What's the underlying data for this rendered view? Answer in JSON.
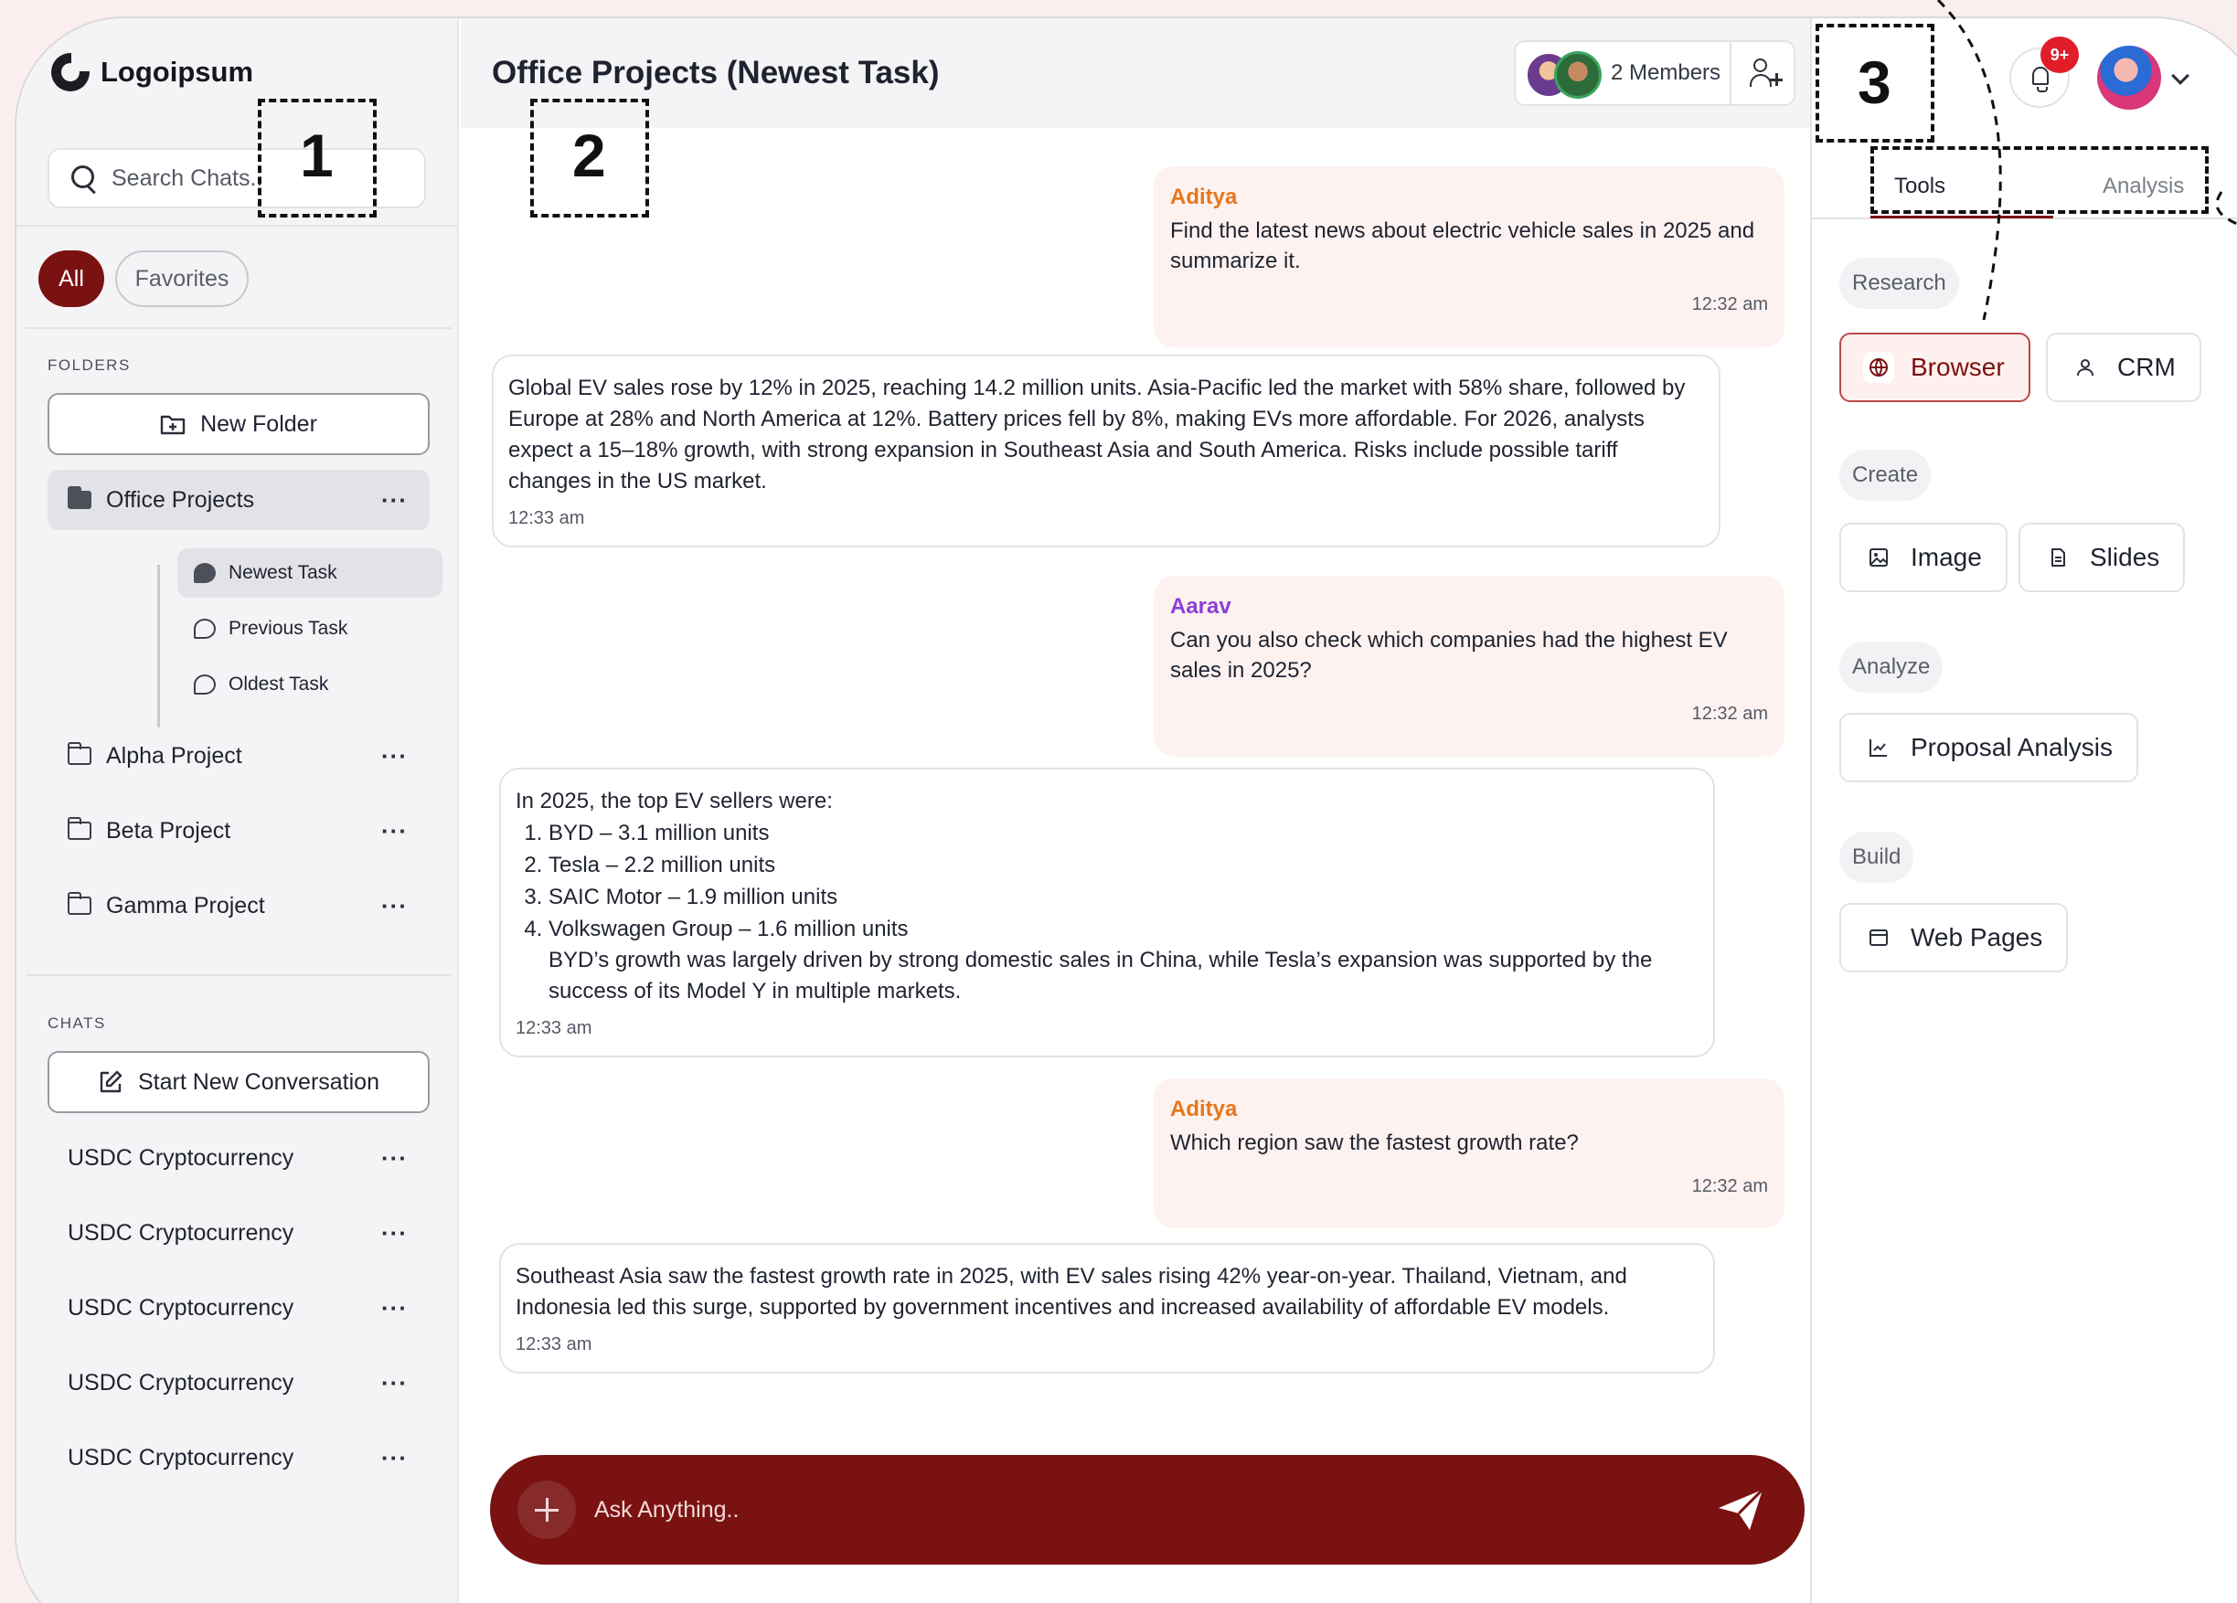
{
  "app": {
    "logo": "Logoipsum"
  },
  "sidebar": {
    "search_placeholder": "Search Chats..",
    "filters": {
      "all": "All",
      "favorites": "Favorites"
    },
    "folders_label": "FOLDERS",
    "new_folder": "New Folder",
    "folders": [
      {
        "label": "Office Projects",
        "active": true
      },
      {
        "label": "Alpha Project"
      },
      {
        "label": "Beta Project"
      },
      {
        "label": "Gamma Project"
      }
    ],
    "subtasks": [
      {
        "label": "Newest Task",
        "active": true
      },
      {
        "label": "Previous Task"
      },
      {
        "label": "Oldest Task"
      }
    ],
    "chats_label": "CHATS",
    "new_conversation": "Start New Conversation",
    "chats": [
      {
        "label": "USDC Cryptocurrency"
      },
      {
        "label": "USDC Cryptocurrency"
      },
      {
        "label": "USDC Cryptocurrency"
      },
      {
        "label": "USDC Cryptocurrency"
      },
      {
        "label": "USDC Cryptocurrency"
      }
    ],
    "more_glyph": "···"
  },
  "header": {
    "title": "Office Projects (Newest Task)",
    "members": "2 Members"
  },
  "messages": [
    {
      "role": "user",
      "name": "Aditya",
      "color": "#e8761b",
      "text": "Find the latest news about electric vehicle sales in 2025 and summarize it.",
      "time": "12:32 am"
    },
    {
      "role": "ai",
      "text": "Global EV sales rose by 12% in 2025, reaching 14.2 million units. Asia-Pacific led the market with 58% share, followed by Europe at 28% and North America at 12%. Battery prices fell by 8%, making EVs more affordable. For 2026, analysts expect a 15–18% growth, with strong expansion in Southeast Asia and South America. Risks include possible tariff changes in the US market.",
      "time": "12:33 am"
    },
    {
      "role": "user",
      "name": "Aarav",
      "color": "#8b3fd9",
      "text": "Can you also check which companies had the highest EV sales in 2025?",
      "time": "12:32 am"
    },
    {
      "role": "ai",
      "intro": "In 2025, the top EV sellers were:",
      "list": [
        "BYD – 3.1 million units",
        "Tesla – 2.2 million units",
        "SAIC Motor – 1.9 million units",
        "Volkswagen Group – 1.6 million units"
      ],
      "text": "BYD’s growth was largely driven by strong domestic sales in China, while Tesla’s expansion was supported by the success of its Model Y in multiple markets.",
      "time": "12:33 am"
    },
    {
      "role": "user",
      "name": "Aditya",
      "color": "#e8761b",
      "text": "Which region saw the fastest growth rate?",
      "time": "12:32 am"
    },
    {
      "role": "ai",
      "text": "Southeast Asia saw the fastest growth rate in 2025, with EV sales rising 42% year-on-year. Thailand, Vietnam, and Indonesia led this surge, supported by government incentives and increased availability of affordable EV models.",
      "time": "12:33 am"
    }
  ],
  "composer": {
    "placeholder": "Ask Anything.."
  },
  "right_panel": {
    "notifications_badge": "9+",
    "tabs": {
      "tools": "Tools",
      "analysis": "Analysis"
    },
    "categories": {
      "research": "Research",
      "create": "Create",
      "analyze": "Analyze",
      "build": "Build"
    },
    "tools": {
      "browser": "Browser",
      "crm": "CRM",
      "image": "Image",
      "slides": "Slides",
      "proposal": "Proposal Analysis",
      "web_pages": "Web Pages"
    }
  },
  "annotations": {
    "one": "1",
    "two": "2",
    "three": "3"
  },
  "colors": {
    "brand": "#7a1212",
    "badge": "#e11d2a"
  }
}
